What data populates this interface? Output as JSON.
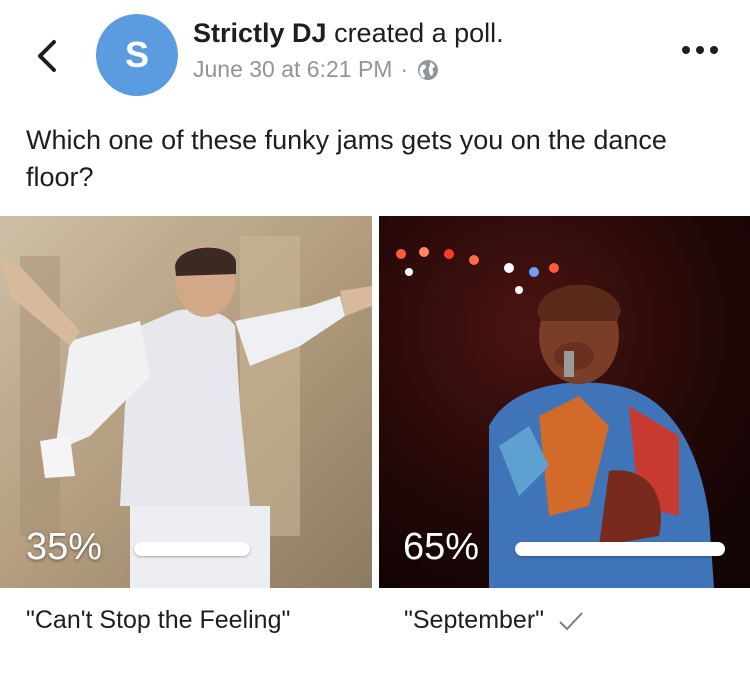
{
  "post": {
    "author": "Strictly DJ",
    "action": " created a poll.",
    "avatar_letter": "S",
    "timestamp": "June 30 at 6:21 PM",
    "separator": "·",
    "privacy_icon": "globe-icon",
    "menu_icon": "more-options-icon",
    "back_icon": "chevron-left-icon"
  },
  "poll": {
    "question": "Which one of these funky jams gets you on the dance floor?",
    "options": [
      {
        "label": "\"Can't Stop the Feeling\"",
        "percent_text": "35%",
        "percent": 35,
        "selected": false
      },
      {
        "label": "\"September\"",
        "percent_text": "65%",
        "percent": 65,
        "selected": true
      }
    ]
  },
  "colors": {
    "avatar": "#5b9ce0",
    "text": "#1c1e21",
    "meta": "#90949c"
  }
}
